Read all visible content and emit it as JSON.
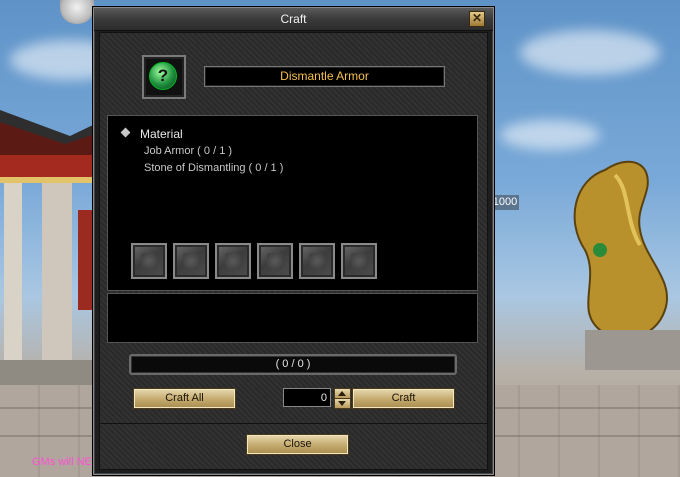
{
  "window": {
    "title": "Craft",
    "close_glyph": "✕"
  },
  "item": {
    "icon": "dismantle-gem-icon",
    "icon_glyph": "?",
    "name": "Dismantle Armor"
  },
  "materials": {
    "heading": "Material",
    "items": [
      "Job Armor ( 0 / 1 )",
      "Stone of Dismantling ( 0 / 1 )"
    ],
    "slot_count": 6
  },
  "progress": {
    "text": "( 0 / 0 )",
    "fraction": 0
  },
  "controls": {
    "craft_all_label": "Craft All",
    "quantity_value": "0",
    "craft_label": "Craft",
    "close_label": "Close"
  },
  "background": {
    "gm_notice": "GMs will NE",
    "number_tag": "1000"
  },
  "colors": {
    "item_name": "#f5c04a",
    "button": "#c7ad72",
    "gm_notice": "#ff4fd2"
  }
}
